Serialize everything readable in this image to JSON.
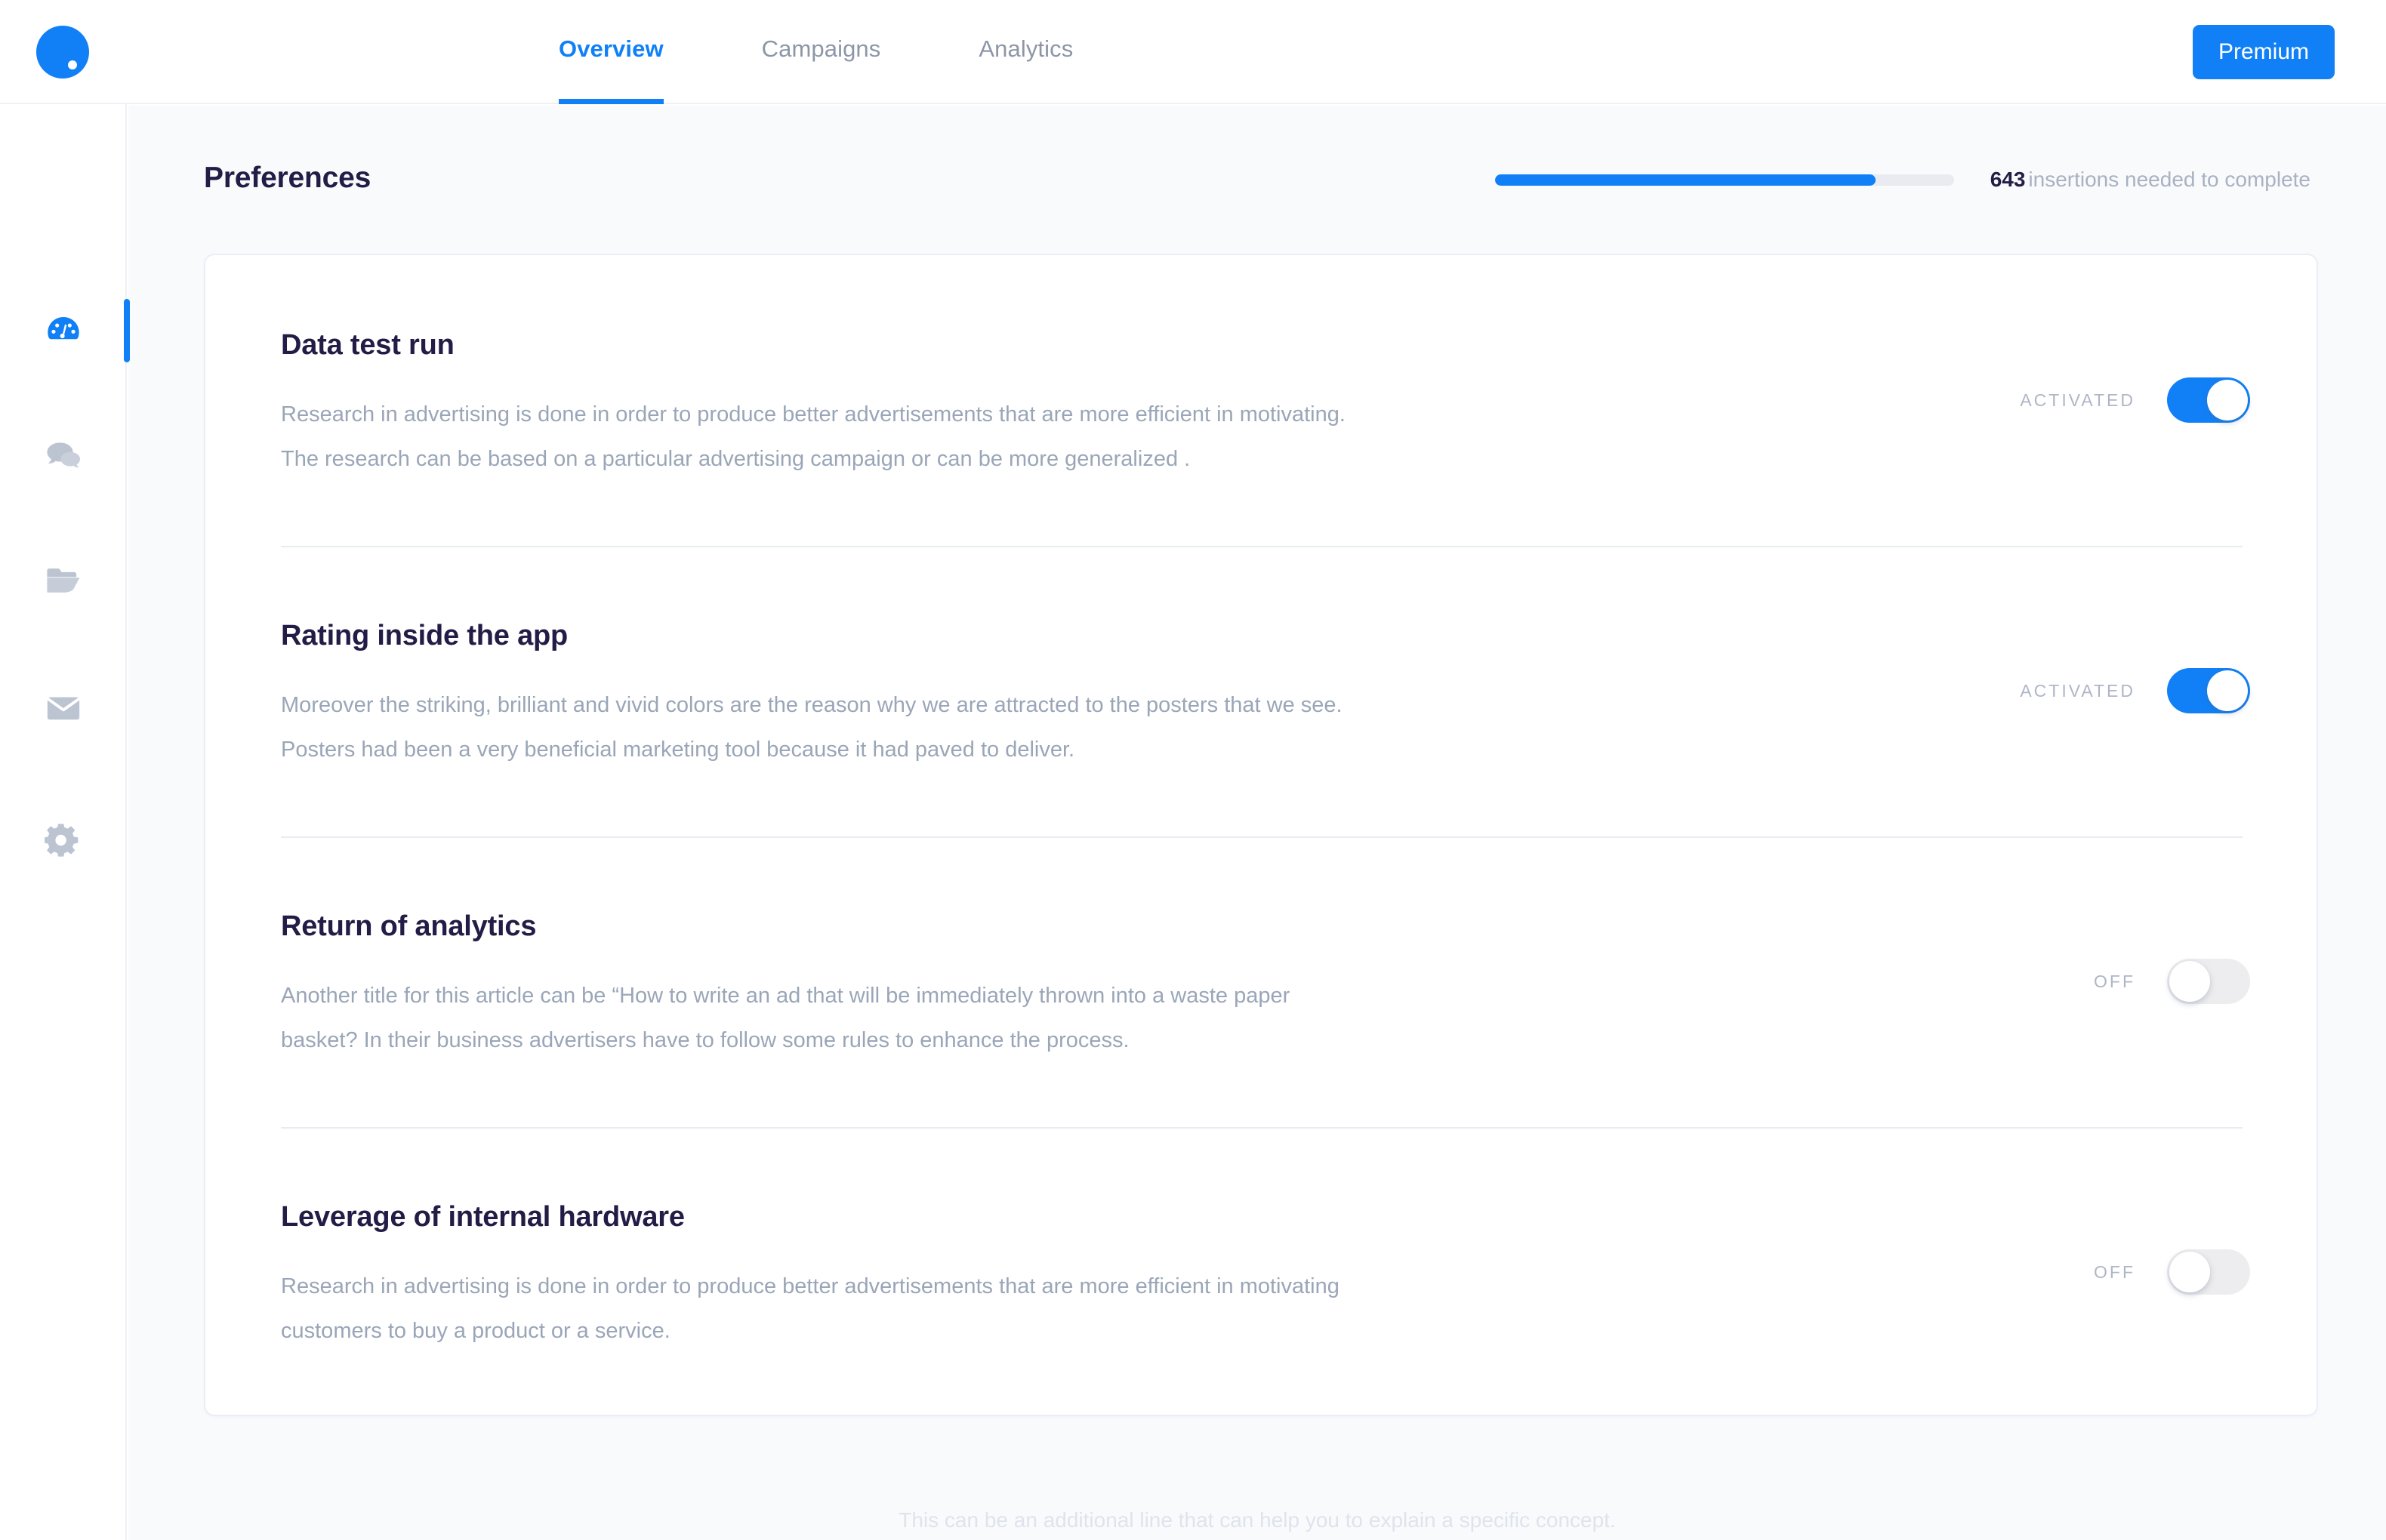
{
  "brand": {
    "logo_icon": "blue-circle-dot-logo"
  },
  "topnav": {
    "tabs": [
      {
        "label": "Overview",
        "active": true
      },
      {
        "label": "Campaigns",
        "active": false
      },
      {
        "label": "Analytics",
        "active": false
      }
    ],
    "premium_label": "Premium",
    "accent_color": "#1180f7"
  },
  "sidebar": {
    "items": [
      {
        "name": "dashboard",
        "icon": "speedometer-icon",
        "active": true
      },
      {
        "name": "messages",
        "icon": "chat-bubbles-icon",
        "active": false
      },
      {
        "name": "files",
        "icon": "open-folder-icon",
        "active": false
      },
      {
        "name": "mail",
        "icon": "envelope-icon",
        "active": false
      },
      {
        "name": "settings",
        "icon": "gear-icon",
        "active": false
      }
    ]
  },
  "header": {
    "title": "Preferences",
    "progress_percent": 83,
    "progress_count": "643",
    "progress_text": "insertions needed to complete"
  },
  "preferences": [
    {
      "title": "Data test run",
      "line1": "Research in advertising is done in order to produce better advertisements that are more efficient in motivating.",
      "line2": "The research can be based on a particular advertising campaign or can be more generalized .",
      "toggle_label": "ACTIVATED",
      "toggle_on": true
    },
    {
      "title": "Rating inside the app",
      "line1": "Moreover the striking, brilliant and vivid colors are the reason why we are attracted to the posters that we see.",
      "line2": "Posters had been a very beneficial marketing tool because it had paved to deliver.",
      "toggle_label": "ACTIVATED",
      "toggle_on": true
    },
    {
      "title": "Return of analytics",
      "line1": "Another title for this article can be “How to write an ad that will be immediately thrown into a waste paper",
      "line2": "basket? In their business advertisers have to follow some rules to enhance the process.",
      "toggle_label": "OFF",
      "toggle_on": false
    },
    {
      "title": "Leverage of internal hardware",
      "line1": "Research in advertising is done in order to produce better advertisements that are more efficient in motivating",
      "line2": "customers to buy a product or a service.",
      "toggle_label": "OFF",
      "toggle_on": false
    }
  ],
  "footer": {
    "note": "This can be an additional line that can help you to explain a specific concept."
  }
}
